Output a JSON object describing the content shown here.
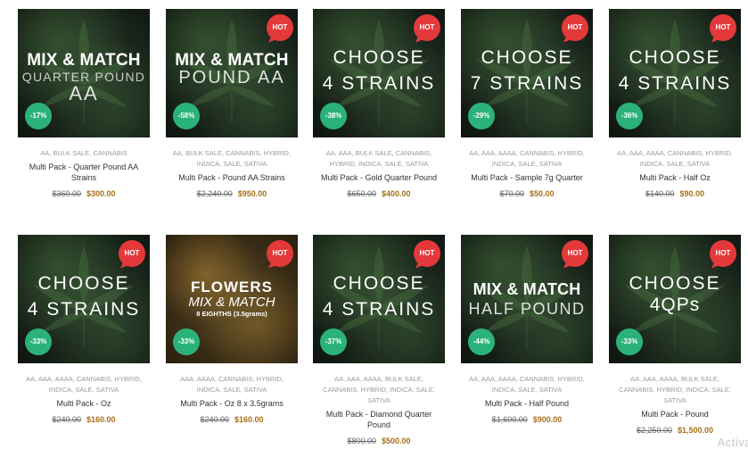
{
  "colors": {
    "hot_badge": "#e3393a",
    "discount_badge": "#2bb27a",
    "sale_price": "#a8701a"
  },
  "products": [
    {
      "image": {
        "line1": "MIX & MATCH",
        "line2": "QUARTER POUND",
        "line3": "AA"
      },
      "hot": "",
      "discount": "-17%",
      "categories": [
        "AA",
        "BULK SALE",
        "CANNABIS"
      ],
      "name": "Multi Pack - Quarter Pound AA Strains",
      "old_price": "$360.00",
      "price": "$300.00"
    },
    {
      "image": {
        "line1": "MIX & MATCH",
        "line2": "POUND AA"
      },
      "hot": "HOT",
      "discount": "-58%",
      "categories": [
        "AA",
        "BULK SALE",
        "CANNABIS",
        "HYBRID",
        "INDICA",
        "SALE",
        "SATIVA"
      ],
      "name": "Multi Pack - Pound AA Strains",
      "old_price": "$2,240.00",
      "price": "$950.00"
    },
    {
      "image": {
        "line1": "CHOOSE",
        "line2": "4 STRAINS"
      },
      "hot": "HOT",
      "discount": "-38%",
      "categories": [
        "AA",
        "AAA",
        "BULK SALE",
        "CANNABIS",
        "HYBRID",
        "INDICA",
        "SALE",
        "SATIVA"
      ],
      "name": "Multi Pack - Gold Quarter Pound",
      "old_price": "$650.00",
      "price": "$400.00"
    },
    {
      "image": {
        "line1": "CHOOSE",
        "line2": "7 STRAINS"
      },
      "hot": "HOT",
      "discount": "-29%",
      "categories": [
        "AA",
        "AAA",
        "AAAA",
        "CANNABIS",
        "HYBRID",
        "INDICA",
        "SALE",
        "SATIVA"
      ],
      "name": "Multi Pack - Sample 7g Quarter",
      "old_price": "$70.00",
      "price": "$50.00"
    },
    {
      "image": {
        "line1": "CHOOSE",
        "line2": "4 STRAINS"
      },
      "hot": "HOT",
      "discount": "-36%",
      "categories": [
        "AA",
        "AAA",
        "AAAA",
        "CANNABIS",
        "HYBRID",
        "INDICA",
        "SALE",
        "SATIVA"
      ],
      "name": "Multi Pack - Half Oz",
      "old_price": "$140.00",
      "price": "$90.00"
    },
    {
      "image": {
        "line1": "CHOOSE",
        "line2": "4 STRAINS"
      },
      "hot": "HOT",
      "discount": "-33%",
      "categories": [
        "AA",
        "AAA",
        "AAAA",
        "CANNABIS",
        "HYBRID",
        "INDICA",
        "SALE",
        "SATIVA"
      ],
      "name": "Multi Pack - Oz",
      "old_price": "$240.00",
      "price": "$160.00"
    },
    {
      "image": {
        "line1": "FLOWERS",
        "line2": "MIX & MATCH",
        "line3": "8 EIGHTHS (3.5grams)"
      },
      "hot": "HOT",
      "discount": "-33%",
      "categories": [
        "AAA",
        "AAAA",
        "CANNABIS",
        "HYBRID",
        "INDICA",
        "SALE",
        "SATIVA"
      ],
      "name": "Multi Pack - Oz 8 x 3.5grams",
      "old_price": "$240.00",
      "price": "$160.00"
    },
    {
      "image": {
        "line1": "CHOOSE",
        "line2": "4 STRAINS"
      },
      "hot": "HOT",
      "discount": "-37%",
      "categories": [
        "AA",
        "AAA",
        "AAAA",
        "BULK SALE",
        "CANNABIS",
        "HYBRID",
        "INDICA",
        "SALE",
        "SATIVA"
      ],
      "name": "Multi Pack - Diamond Quarter Pound",
      "old_price": "$800.00",
      "price": "$500.00"
    },
    {
      "image": {
        "line1": "MIX & MATCH",
        "line2": "HALF POUND"
      },
      "hot": "HOT",
      "discount": "-44%",
      "categories": [
        "AA",
        "AAA",
        "AAAA",
        "CANNABIS",
        "HYBRID",
        "INDICA",
        "SALE",
        "SATIVA"
      ],
      "name": "Multi Pack - Half Pound",
      "old_price": "$1,600.00",
      "price": "$900.00"
    },
    {
      "image": {
        "line1": "CHOOSE",
        "line2": "4QPs"
      },
      "hot": "HOT",
      "discount": "-33%",
      "categories": [
        "AA",
        "AAA",
        "AAAA",
        "BULK SALE",
        "CANNABIS",
        "HYBRID",
        "INDICA",
        "SALE",
        "SATIVA"
      ],
      "name": "Multi Pack - Pound",
      "old_price": "$2,250.00",
      "price": "$1,500.00"
    }
  ],
  "watermark": "Activa"
}
